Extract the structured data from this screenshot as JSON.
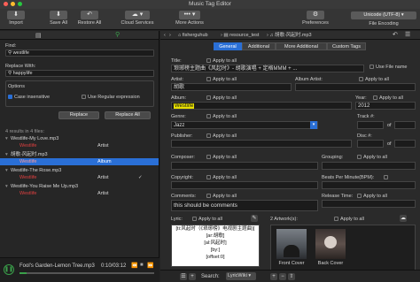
{
  "window": {
    "title": "Music Tag Editor"
  },
  "toolbar": {
    "import": "Import",
    "save_all": "Save All",
    "restore_all": "Restore All",
    "cloud_services": "Cloud Services",
    "more_actions": "More Actions",
    "preferences": "Preferences",
    "encoding_value": "Unicode (UTF-8)",
    "encoding_label": "File Encoding"
  },
  "search": {
    "find_label": "Find:",
    "find_value": "westlife",
    "replace_label": "Replace With:",
    "replace_value": "happylife",
    "options_label": "Options",
    "case_insensitive": "Case insensitive",
    "use_regex": "Use Regular expression",
    "replace_button": "Replace",
    "replace_all_button": "Replace All",
    "results_summary": "4 results in 4 files:"
  },
  "results": [
    {
      "file": "Westlife-My Love.mp3",
      "match": "Westlife",
      "field": "Artist"
    },
    {
      "file": "胡歌-风起时.mp3",
      "match": "Westlife",
      "field": "Album"
    },
    {
      "file": "Westlife-The Rose.mp3",
      "match": "Westlife",
      "field": "Artist"
    },
    {
      "file": "Westlife-You Raise Me Up.mp3",
      "match": "Westlife",
      "field": "Artist"
    }
  ],
  "player": {
    "track": "Fool's Garden-Lemon Tree.mp3",
    "time": "0:10/03:12",
    "progress": 0.05
  },
  "path": {
    "home": "fisherguhub",
    "folder": "resource_test",
    "file": "胡歌-风起时.mp3"
  },
  "tabs": [
    "General",
    "Additional",
    "More Additional",
    "Custom Tags"
  ],
  "apply_to_all": "Apply to all",
  "tag": {
    "title_label": "Title:",
    "title_value": "琅琊榜主题曲《风起时》- 胡歌演唱 + 定格MMM + ...",
    "use_file_name": "Use File name",
    "artist_label": "Artist:",
    "artist_value": "胡歌",
    "album_artist_label": "Album Artist:",
    "album_label": "Album:",
    "album_value": "Westlife",
    "year_label": "Year:",
    "year_value": "2012",
    "genre_label": "Genre:",
    "genre_value": "Jazz",
    "track_label": "Track #:",
    "of_label": "of",
    "publisher_label": "Publisher:",
    "disc_label": "Disc #:",
    "composer_label": "Composer:",
    "grouping_label": "Grouping:",
    "copyright_label": "Copyright:",
    "bpm_label": "Beats Per Minute(BPM):",
    "comments_label": "Comments:",
    "comments_value": "this should be comments",
    "release_label": "Release Time:",
    "lyric_label": "Lyric:",
    "lyric_lines": [
      "[ti:风起时（《琅琊榜》电视剧主题曲)]",
      "[ar:胡歌]",
      "[al:风起时]",
      "[by:]",
      "[offset:0]"
    ],
    "artwork_label": "2 Artwork(s):",
    "front_cover": "Front Cover",
    "back_cover": "Back Cover",
    "search_label": "Search:",
    "search_value": "LyricWiki"
  },
  "colors": {
    "accent": "#2a6fd6",
    "highlight": "#e8e000",
    "match_red": "#e04040"
  }
}
